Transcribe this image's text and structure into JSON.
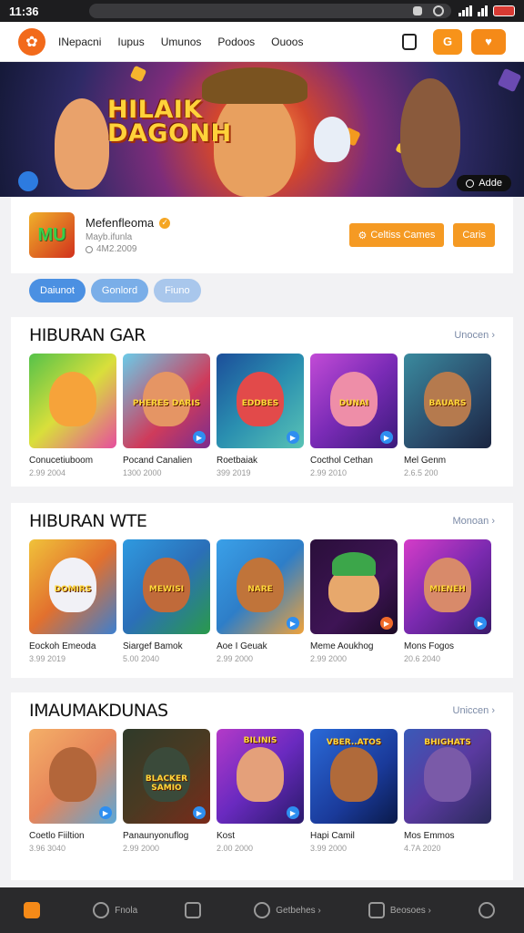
{
  "status_bar": {
    "time": "11:36"
  },
  "nav": {
    "logo_glyph": "✿",
    "links": [
      "INepacni",
      "Iupus",
      "Umunos",
      "Podoos",
      "Ouoos"
    ],
    "btn_user_glyph": "G",
    "btn_cart_glyph": "♥"
  },
  "hero": {
    "title_line1": "HILAIK",
    "title_line2": "DAGONH",
    "badge": "Adde"
  },
  "profile": {
    "logo_text": "MU",
    "name": "Mefenfleoma",
    "subtitle": "Mayb.ifunla",
    "stat": "4M2.2009",
    "btn_primary": "Celtiss Cames",
    "btn_secondary": "Caris"
  },
  "tabs": [
    "Daiunot",
    "Gonlord",
    "Fiuno"
  ],
  "sections": [
    {
      "title": "HIBURAN GAR",
      "more": "Unocen ›",
      "cards": [
        {
          "name": "Conucetiuboom",
          "meta": "2.99 2004",
          "caption": ""
        },
        {
          "name": "Pocand Canalien",
          "meta": "1300 2000",
          "caption": "PHERES DARIS"
        },
        {
          "name": "Roetbaiak",
          "meta": "399 2019",
          "caption": "EDDBES"
        },
        {
          "name": "Cocthol Cethan",
          "meta": "2.99 2010",
          "caption": "DUNAI"
        },
        {
          "name": "Mel Genm",
          "meta": "2.6.5 200",
          "caption": "BAUARS"
        }
      ]
    },
    {
      "title": "HIBURAN WTE",
      "more": "Monoan ›",
      "cards": [
        {
          "name": "Eockoh Emeoda",
          "meta": "3.99 2019",
          "caption": "DOMIRS"
        },
        {
          "name": "Siargef Bamok",
          "meta": "5.00 2040",
          "caption": "MEWISI"
        },
        {
          "name": "Aoe I Geuak",
          "meta": "2.99 2000",
          "caption": "NARE"
        },
        {
          "name": "Meme Aoukhog",
          "meta": "2.99 2000",
          "caption": ""
        },
        {
          "name": "Mons Fogos",
          "meta": "20.6 2040",
          "caption": "MIENEH"
        }
      ]
    },
    {
      "title": "IMAUMAKDUNAS",
      "more": "Uniccen ›",
      "cards": [
        {
          "name": "Coetlo Fiiltion",
          "meta": "3.96 3040",
          "caption": ""
        },
        {
          "name": "Panaunyonuflog",
          "meta": "2.99 2000",
          "caption": "BLACKER SAMIO"
        },
        {
          "name": "Kost",
          "meta": "2.00 2000",
          "caption": "BILINIS"
        },
        {
          "name": "Hapi Camil",
          "meta": "3.99 2000",
          "caption": "VBER..ATOS"
        },
        {
          "name": "Mos Emmos",
          "meta": "4.7A 2020",
          "caption": "BHIGHATS"
        }
      ]
    }
  ],
  "bottom_bar": [
    "",
    "Fnola",
    "",
    "Getbehes ›",
    "Beosoes ›",
    ""
  ]
}
